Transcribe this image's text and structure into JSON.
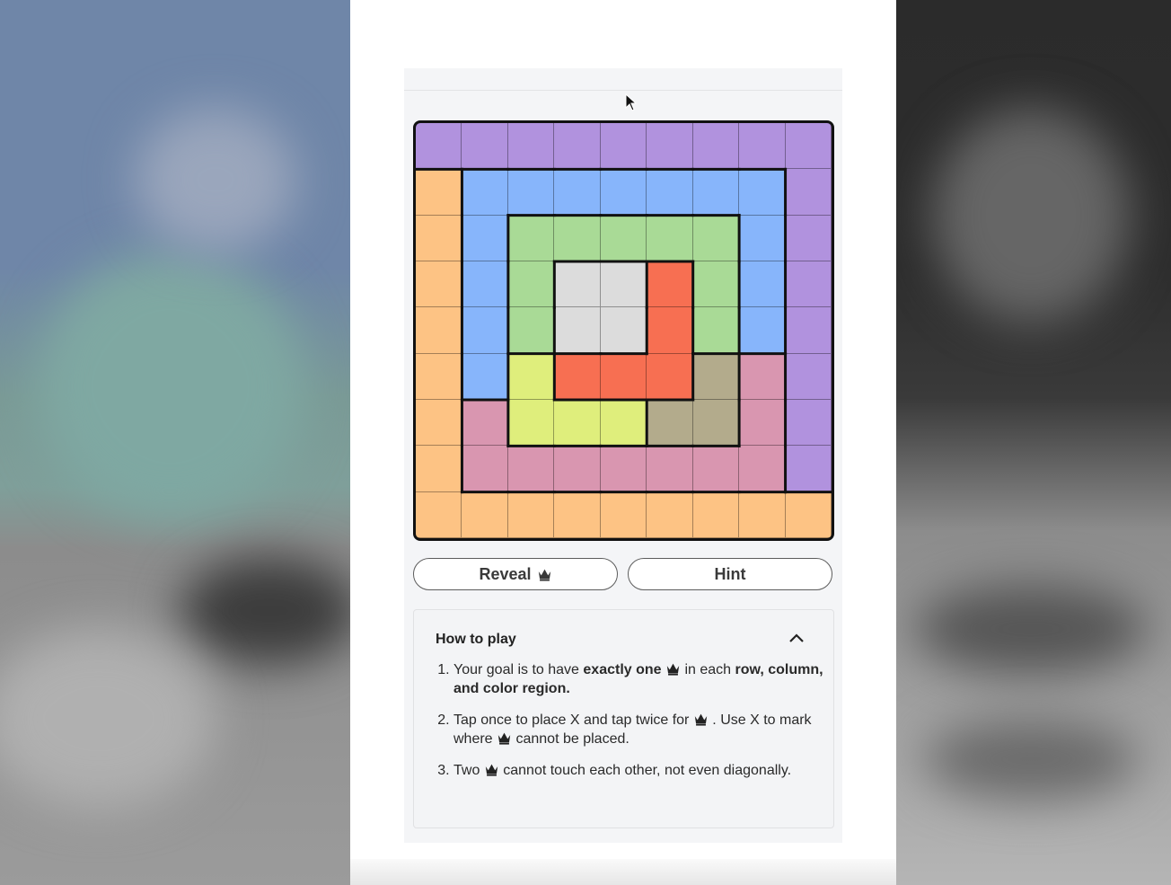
{
  "colors": {
    "purple": "#b192de",
    "orange": "#fdc384",
    "blue": "#87b5fb",
    "green": "#a9da96",
    "gray": "#dcdcdc",
    "red": "#f76f52",
    "yellow": "#dfee7c",
    "tan": "#b3ab8c",
    "pink": "#d996b0"
  },
  "board": {
    "size": 9,
    "regions": [
      [
        "purple",
        "purple",
        "purple",
        "purple",
        "purple",
        "purple",
        "purple",
        "purple",
        "purple"
      ],
      [
        "orange",
        "blue",
        "blue",
        "blue",
        "blue",
        "blue",
        "blue",
        "blue",
        "purple"
      ],
      [
        "orange",
        "blue",
        "green",
        "green",
        "green",
        "green",
        "green",
        "blue",
        "purple"
      ],
      [
        "orange",
        "blue",
        "green",
        "gray",
        "gray",
        "red",
        "green",
        "blue",
        "purple"
      ],
      [
        "orange",
        "blue",
        "green",
        "gray",
        "gray",
        "red",
        "green",
        "blue",
        "purple"
      ],
      [
        "orange",
        "blue",
        "yellow",
        "red",
        "red",
        "red",
        "tan",
        "pink",
        "purple"
      ],
      [
        "orange",
        "pink",
        "yellow",
        "yellow",
        "yellow",
        "tan",
        "tan",
        "pink",
        "purple"
      ],
      [
        "orange",
        "pink",
        "pink",
        "pink",
        "pink",
        "pink",
        "pink",
        "pink",
        "purple"
      ],
      [
        "orange",
        "orange",
        "orange",
        "orange",
        "orange",
        "orange",
        "orange",
        "orange",
        "orange"
      ]
    ]
  },
  "buttons": {
    "reveal": "Reveal",
    "hint": "Hint"
  },
  "howto": {
    "title": "How to play",
    "rule1_a": "Your goal is to have ",
    "rule1_b": "exactly one",
    "rule1_c": " in each ",
    "rule1_d": "row, column, and color region.",
    "rule2_a": "Tap once to place X and tap twice for",
    "rule2_b": ". Use X to mark where",
    "rule2_c": "cannot be placed.",
    "rule3_a": "Two",
    "rule3_b": "cannot touch each other, not even diagonally."
  },
  "icons": {
    "crown": "crown-icon",
    "collapse": "chevron-up-icon",
    "pointer": "mouse-cursor-icon"
  }
}
